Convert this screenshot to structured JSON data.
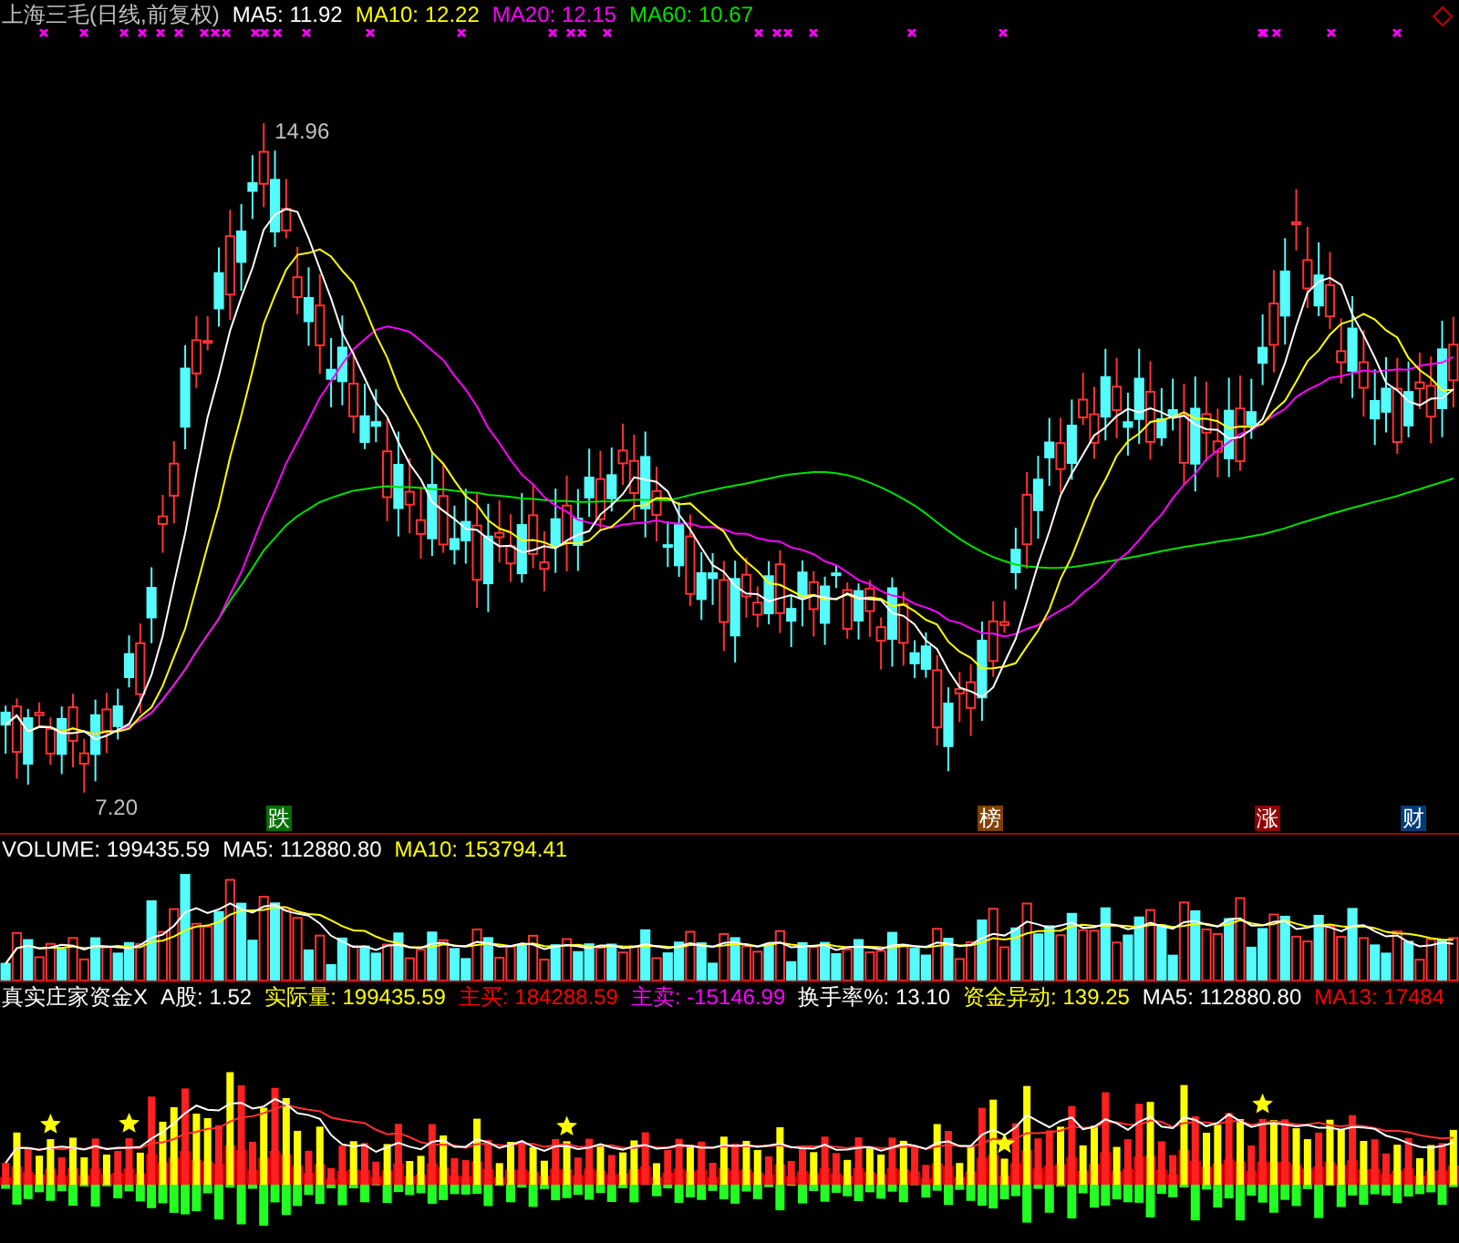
{
  "price_panel": {
    "stock": "上海三毛(日线,前复权)",
    "indicators": [
      {
        "label": "MA5:",
        "value": "11.92",
        "color": "#ffffff"
      },
      {
        "label": "MA10:",
        "value": "12.22",
        "color": "#ffff00"
      },
      {
        "label": "MA20:",
        "value": "12.15",
        "color": "#ff00ff"
      },
      {
        "label": "MA60:",
        "value": "10.67",
        "color": "#00e000"
      }
    ],
    "high_label": "14.96",
    "low_label": "7.20",
    "signals": [
      {
        "text": "跌",
        "color": "#007000"
      },
      {
        "text": "榜",
        "color": "#804000"
      },
      {
        "text": "涨",
        "color": "#900000"
      },
      {
        "text": "财",
        "color": "#003c78"
      }
    ]
  },
  "volume_panel": {
    "indicators": [
      {
        "label": "VOLUME:",
        "value": "199435.59",
        "color": "#ffffff"
      },
      {
        "label": "MA5:",
        "value": "112880.80",
        "color": "#ffffff"
      },
      {
        "label": "MA10:",
        "value": "153794.41",
        "color": "#ffff00"
      }
    ]
  },
  "fund_panel": {
    "title": "真实庄家资金X",
    "indicators": [
      {
        "label": "A股:",
        "value": "1.52",
        "color": "#ffffff"
      },
      {
        "label": "实际量:",
        "value": "199435.59",
        "color": "#ffff00"
      },
      {
        "label": "主买:",
        "value": "184288.59",
        "color": "#ff0000"
      },
      {
        "label": "主卖:",
        "value": "-15146.99",
        "color": "#ff00ff"
      },
      {
        "label": "换手率%:",
        "value": "13.10",
        "color": "#ffffff"
      },
      {
        "label": "资金异动:",
        "value": "139.25",
        "color": "#ffff00"
      },
      {
        "label": "MA5:",
        "value": "112880.80",
        "color": "#ffffff"
      },
      {
        "label": "MA13:",
        "value": "17484",
        "color": "#ff0000"
      }
    ]
  }
}
